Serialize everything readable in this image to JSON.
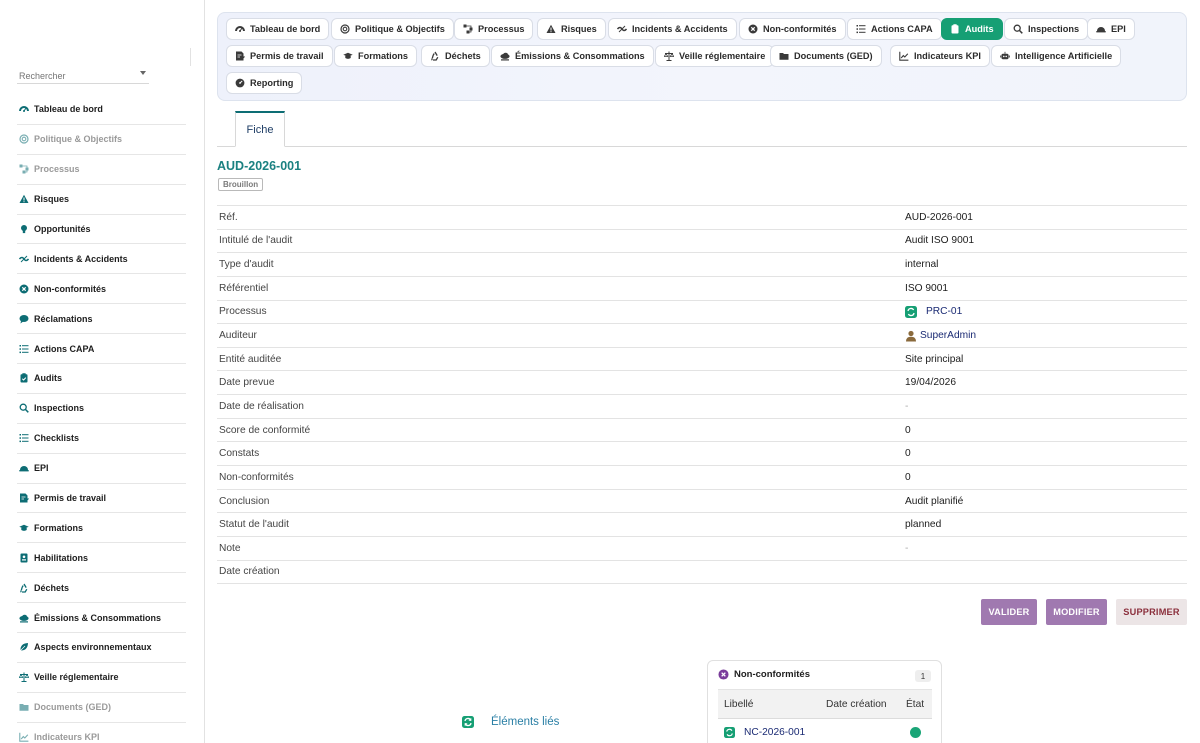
{
  "sidebar": {
    "search": {
      "placeholder": "Rechercher"
    },
    "items": [
      {
        "label": "Tableau de bord",
        "icon": "dashboard-icon",
        "muted": false
      },
      {
        "label": "Politique & Objectifs",
        "icon": "target-icon",
        "muted": true
      },
      {
        "label": "Processus",
        "icon": "process-icon",
        "muted": true
      },
      {
        "label": "Risques",
        "icon": "warning-icon",
        "muted": false
      },
      {
        "label": "Opportunités",
        "icon": "lightbulb-icon",
        "muted": false
      },
      {
        "label": "Incidents & Accidents",
        "icon": "incident-icon",
        "muted": false
      },
      {
        "label": "Non-conformités",
        "icon": "x-circle-icon",
        "muted": false
      },
      {
        "label": "Réclamations",
        "icon": "comment-icon",
        "muted": false
      },
      {
        "label": "Actions CAPA",
        "icon": "list-icon",
        "muted": false
      },
      {
        "label": "Audits",
        "icon": "clipboard-icon",
        "muted": false
      },
      {
        "label": "Inspections",
        "icon": "search-icon",
        "muted": false
      },
      {
        "label": "Checklists",
        "icon": "checklist-icon",
        "muted": false
      },
      {
        "label": "EPI",
        "icon": "helmet-icon",
        "muted": false
      },
      {
        "label": "Permis de travail",
        "icon": "permit-icon",
        "muted": false
      },
      {
        "label": "Formations",
        "icon": "graduation-icon",
        "muted": false
      },
      {
        "label": "Habilitations",
        "icon": "badge-icon",
        "muted": false
      },
      {
        "label": "Déchets",
        "icon": "recycle-icon",
        "muted": false
      },
      {
        "label": "Émissions & Consommations",
        "icon": "cloud-icon",
        "muted": false
      },
      {
        "label": "Aspects environnementaux",
        "icon": "leaf-icon",
        "muted": false
      },
      {
        "label": "Veille réglementaire",
        "icon": "balance-icon",
        "muted": false
      },
      {
        "label": "Documents (GED)",
        "icon": "folder-icon",
        "muted": true
      },
      {
        "label": "Indicateurs KPI",
        "icon": "chart-icon",
        "muted": true
      }
    ]
  },
  "topnav": {
    "items": [
      {
        "label": "Tableau de bord",
        "icon": "dashboard-icon",
        "active": false
      },
      {
        "label": "Politique & Objectifs",
        "icon": "target-icon",
        "active": false
      },
      {
        "label": "Processus",
        "icon": "process-icon",
        "active": false
      },
      {
        "label": "Risques",
        "icon": "warning-icon",
        "active": false
      },
      {
        "label": "Incidents & Accidents",
        "icon": "incident-icon",
        "active": false
      },
      {
        "label": "Non-conformités",
        "icon": "x-circle-icon",
        "active": false
      },
      {
        "label": "Actions CAPA",
        "icon": "list-icon",
        "active": false
      },
      {
        "label": "Audits",
        "icon": "clipboard-icon",
        "active": true
      },
      {
        "label": "Inspections",
        "icon": "search-icon",
        "active": false
      },
      {
        "label": "EPI",
        "icon": "helmet-icon",
        "active": false
      },
      {
        "label": "Permis de travail",
        "icon": "permit-icon",
        "active": false
      },
      {
        "label": "Formations",
        "icon": "graduation-icon",
        "active": false
      },
      {
        "label": "Déchets",
        "icon": "recycle-icon",
        "active": false
      },
      {
        "label": "Émissions & Consommations",
        "icon": "cloud-icon",
        "active": false
      },
      {
        "label": "Veille réglementaire",
        "icon": "balance-icon",
        "active": false
      },
      {
        "label": "Documents (GED)",
        "icon": "folder-icon",
        "active": false
      },
      {
        "label": "Indicateurs KPI",
        "icon": "chart-icon",
        "active": false
      },
      {
        "label": "Intelligence Artificielle",
        "icon": "robot-icon",
        "active": false
      },
      {
        "label": "Reporting",
        "icon": "gauge-icon",
        "active": false
      }
    ]
  },
  "tabs": {
    "fiche": "Fiche"
  },
  "record": {
    "title": "AUD-2026-001",
    "status": "Brouillon",
    "fields": [
      {
        "label": "Réf.",
        "value": "AUD-2026-001"
      },
      {
        "label": "Intitulé de l'audit",
        "value": "Audit ISO 9001"
      },
      {
        "label": "Type d'audit",
        "value": "internal"
      },
      {
        "label": "Référentiel",
        "value": "ISO 9001"
      },
      {
        "label": "Processus",
        "value": "PRC-01",
        "kind": "process-link"
      },
      {
        "label": "Auditeur",
        "value": "SuperAdmin",
        "kind": "user-link"
      },
      {
        "label": "Entité auditée",
        "value": "Site principal"
      },
      {
        "label": "Date prevue",
        "value": "19/04/2026"
      },
      {
        "label": "Date de réalisation",
        "value": "-",
        "kind": "dash"
      },
      {
        "label": "Score de conformité",
        "value": "0"
      },
      {
        "label": "Constats",
        "value": "0"
      },
      {
        "label": "Non-conformités",
        "value": "0"
      },
      {
        "label": "Conclusion",
        "value": "Audit planifié"
      },
      {
        "label": "Statut de l'audit",
        "value": "planned"
      },
      {
        "label": "Note",
        "value": "-",
        "kind": "dash"
      },
      {
        "label": "Date création",
        "value": ""
      }
    ]
  },
  "actions": {
    "valider": "VALIDER",
    "modifier": "MODIFIER",
    "supprimer": "SUPPRIMER"
  },
  "linked": {
    "title": "Éléments liés"
  },
  "nc_card": {
    "title": "Non-conformités",
    "count": "1",
    "columns": [
      "Libellé",
      "Date création",
      "État"
    ],
    "rows": [
      {
        "ref": "NC-2026-001",
        "status_color": "#1aa577"
      }
    ]
  },
  "colors": {
    "accent": "#169f74",
    "title": "#1b8181",
    "action": "#a079b0",
    "danger": "#8b2f3c"
  }
}
